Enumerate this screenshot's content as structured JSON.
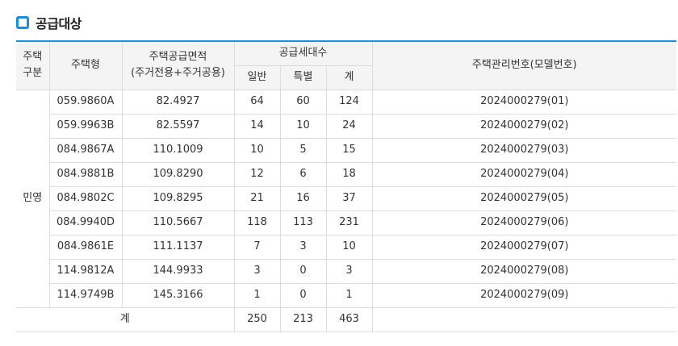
{
  "section": {
    "title": "공급대상"
  },
  "table": {
    "headers": {
      "house_div": "주택\n구분",
      "house_type": "주택형",
      "area": "주택공급면적\n(주거전용+주거공용)",
      "households": "공급세대수",
      "general": "일반",
      "special": "특별",
      "total": "계",
      "mgmt_no": "주택관리번호(모델번호)"
    },
    "group_label": "민영",
    "rows": [
      {
        "type": "059.9860A",
        "area": "82.4927",
        "general": "64",
        "special": "60",
        "total": "124",
        "mgmt": "2024000279(01)"
      },
      {
        "type": "059.9963B",
        "area": "82.5597",
        "general": "14",
        "special": "10",
        "total": "24",
        "mgmt": "2024000279(02)"
      },
      {
        "type": "084.9867A",
        "area": "110.1009",
        "general": "10",
        "special": "5",
        "total": "15",
        "mgmt": "2024000279(03)"
      },
      {
        "type": "084.9881B",
        "area": "109.8290",
        "general": "12",
        "special": "6",
        "total": "18",
        "mgmt": "2024000279(04)"
      },
      {
        "type": "084.9802C",
        "area": "109.8295",
        "general": "21",
        "special": "16",
        "total": "37",
        "mgmt": "2024000279(05)"
      },
      {
        "type": "084.9940D",
        "area": "110.5667",
        "general": "118",
        "special": "113",
        "total": "231",
        "mgmt": "2024000279(06)"
      },
      {
        "type": "084.9861E",
        "area": "111.1137",
        "general": "7",
        "special": "3",
        "total": "10",
        "mgmt": "2024000279(07)"
      },
      {
        "type": "114.9812A",
        "area": "144.9933",
        "general": "3",
        "special": "0",
        "total": "3",
        "mgmt": "2024000279(08)"
      },
      {
        "type": "114.9749B",
        "area": "145.3166",
        "general": "1",
        "special": "0",
        "total": "1",
        "mgmt": "2024000279(09)"
      }
    ],
    "footer": {
      "label": "계",
      "general": "250",
      "special": "213",
      "total": "463"
    }
  },
  "colors": {
    "accent": "#1a8fe0",
    "header_bg": "#f4f4f4",
    "border": "#dcdcdc"
  }
}
